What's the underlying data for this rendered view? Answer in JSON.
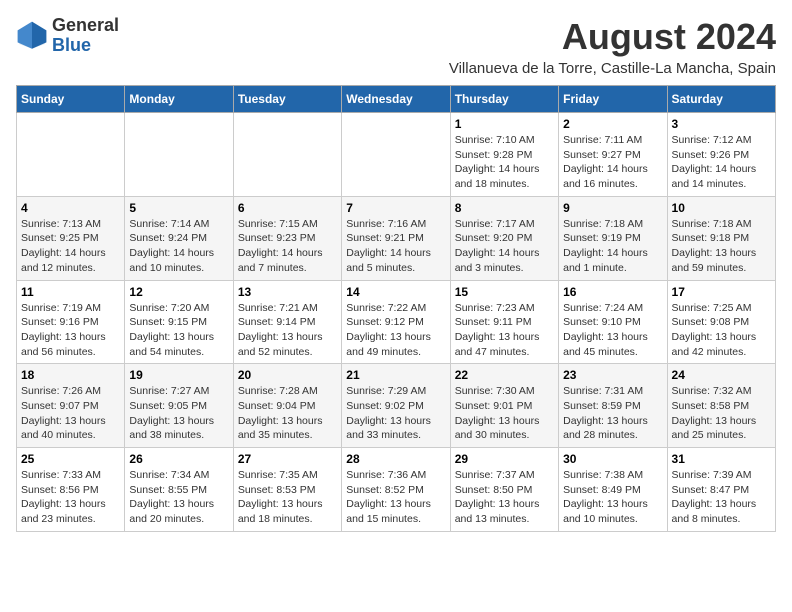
{
  "logo": {
    "general": "General",
    "blue": "Blue"
  },
  "title": "August 2024",
  "subtitle": "Villanueva de la Torre, Castille-La Mancha, Spain",
  "days_of_week": [
    "Sunday",
    "Monday",
    "Tuesday",
    "Wednesday",
    "Thursday",
    "Friday",
    "Saturday"
  ],
  "weeks": [
    [
      {
        "day": "",
        "detail": ""
      },
      {
        "day": "",
        "detail": ""
      },
      {
        "day": "",
        "detail": ""
      },
      {
        "day": "",
        "detail": ""
      },
      {
        "day": "1",
        "detail": "Sunrise: 7:10 AM\nSunset: 9:28 PM\nDaylight: 14 hours\nand 18 minutes."
      },
      {
        "day": "2",
        "detail": "Sunrise: 7:11 AM\nSunset: 9:27 PM\nDaylight: 14 hours\nand 16 minutes."
      },
      {
        "day": "3",
        "detail": "Sunrise: 7:12 AM\nSunset: 9:26 PM\nDaylight: 14 hours\nand 14 minutes."
      }
    ],
    [
      {
        "day": "4",
        "detail": "Sunrise: 7:13 AM\nSunset: 9:25 PM\nDaylight: 14 hours\nand 12 minutes."
      },
      {
        "day": "5",
        "detail": "Sunrise: 7:14 AM\nSunset: 9:24 PM\nDaylight: 14 hours\nand 10 minutes."
      },
      {
        "day": "6",
        "detail": "Sunrise: 7:15 AM\nSunset: 9:23 PM\nDaylight: 14 hours\nand 7 minutes."
      },
      {
        "day": "7",
        "detail": "Sunrise: 7:16 AM\nSunset: 9:21 PM\nDaylight: 14 hours\nand 5 minutes."
      },
      {
        "day": "8",
        "detail": "Sunrise: 7:17 AM\nSunset: 9:20 PM\nDaylight: 14 hours\nand 3 minutes."
      },
      {
        "day": "9",
        "detail": "Sunrise: 7:18 AM\nSunset: 9:19 PM\nDaylight: 14 hours\nand 1 minute."
      },
      {
        "day": "10",
        "detail": "Sunrise: 7:18 AM\nSunset: 9:18 PM\nDaylight: 13 hours\nand 59 minutes."
      }
    ],
    [
      {
        "day": "11",
        "detail": "Sunrise: 7:19 AM\nSunset: 9:16 PM\nDaylight: 13 hours\nand 56 minutes."
      },
      {
        "day": "12",
        "detail": "Sunrise: 7:20 AM\nSunset: 9:15 PM\nDaylight: 13 hours\nand 54 minutes."
      },
      {
        "day": "13",
        "detail": "Sunrise: 7:21 AM\nSunset: 9:14 PM\nDaylight: 13 hours\nand 52 minutes."
      },
      {
        "day": "14",
        "detail": "Sunrise: 7:22 AM\nSunset: 9:12 PM\nDaylight: 13 hours\nand 49 minutes."
      },
      {
        "day": "15",
        "detail": "Sunrise: 7:23 AM\nSunset: 9:11 PM\nDaylight: 13 hours\nand 47 minutes."
      },
      {
        "day": "16",
        "detail": "Sunrise: 7:24 AM\nSunset: 9:10 PM\nDaylight: 13 hours\nand 45 minutes."
      },
      {
        "day": "17",
        "detail": "Sunrise: 7:25 AM\nSunset: 9:08 PM\nDaylight: 13 hours\nand 42 minutes."
      }
    ],
    [
      {
        "day": "18",
        "detail": "Sunrise: 7:26 AM\nSunset: 9:07 PM\nDaylight: 13 hours\nand 40 minutes."
      },
      {
        "day": "19",
        "detail": "Sunrise: 7:27 AM\nSunset: 9:05 PM\nDaylight: 13 hours\nand 38 minutes."
      },
      {
        "day": "20",
        "detail": "Sunrise: 7:28 AM\nSunset: 9:04 PM\nDaylight: 13 hours\nand 35 minutes."
      },
      {
        "day": "21",
        "detail": "Sunrise: 7:29 AM\nSunset: 9:02 PM\nDaylight: 13 hours\nand 33 minutes."
      },
      {
        "day": "22",
        "detail": "Sunrise: 7:30 AM\nSunset: 9:01 PM\nDaylight: 13 hours\nand 30 minutes."
      },
      {
        "day": "23",
        "detail": "Sunrise: 7:31 AM\nSunset: 8:59 PM\nDaylight: 13 hours\nand 28 minutes."
      },
      {
        "day": "24",
        "detail": "Sunrise: 7:32 AM\nSunset: 8:58 PM\nDaylight: 13 hours\nand 25 minutes."
      }
    ],
    [
      {
        "day": "25",
        "detail": "Sunrise: 7:33 AM\nSunset: 8:56 PM\nDaylight: 13 hours\nand 23 minutes."
      },
      {
        "day": "26",
        "detail": "Sunrise: 7:34 AM\nSunset: 8:55 PM\nDaylight: 13 hours\nand 20 minutes."
      },
      {
        "day": "27",
        "detail": "Sunrise: 7:35 AM\nSunset: 8:53 PM\nDaylight: 13 hours\nand 18 minutes."
      },
      {
        "day": "28",
        "detail": "Sunrise: 7:36 AM\nSunset: 8:52 PM\nDaylight: 13 hours\nand 15 minutes."
      },
      {
        "day": "29",
        "detail": "Sunrise: 7:37 AM\nSunset: 8:50 PM\nDaylight: 13 hours\nand 13 minutes."
      },
      {
        "day": "30",
        "detail": "Sunrise: 7:38 AM\nSunset: 8:49 PM\nDaylight: 13 hours\nand 10 minutes."
      },
      {
        "day": "31",
        "detail": "Sunrise: 7:39 AM\nSunset: 8:47 PM\nDaylight: 13 hours\nand 8 minutes."
      }
    ]
  ]
}
